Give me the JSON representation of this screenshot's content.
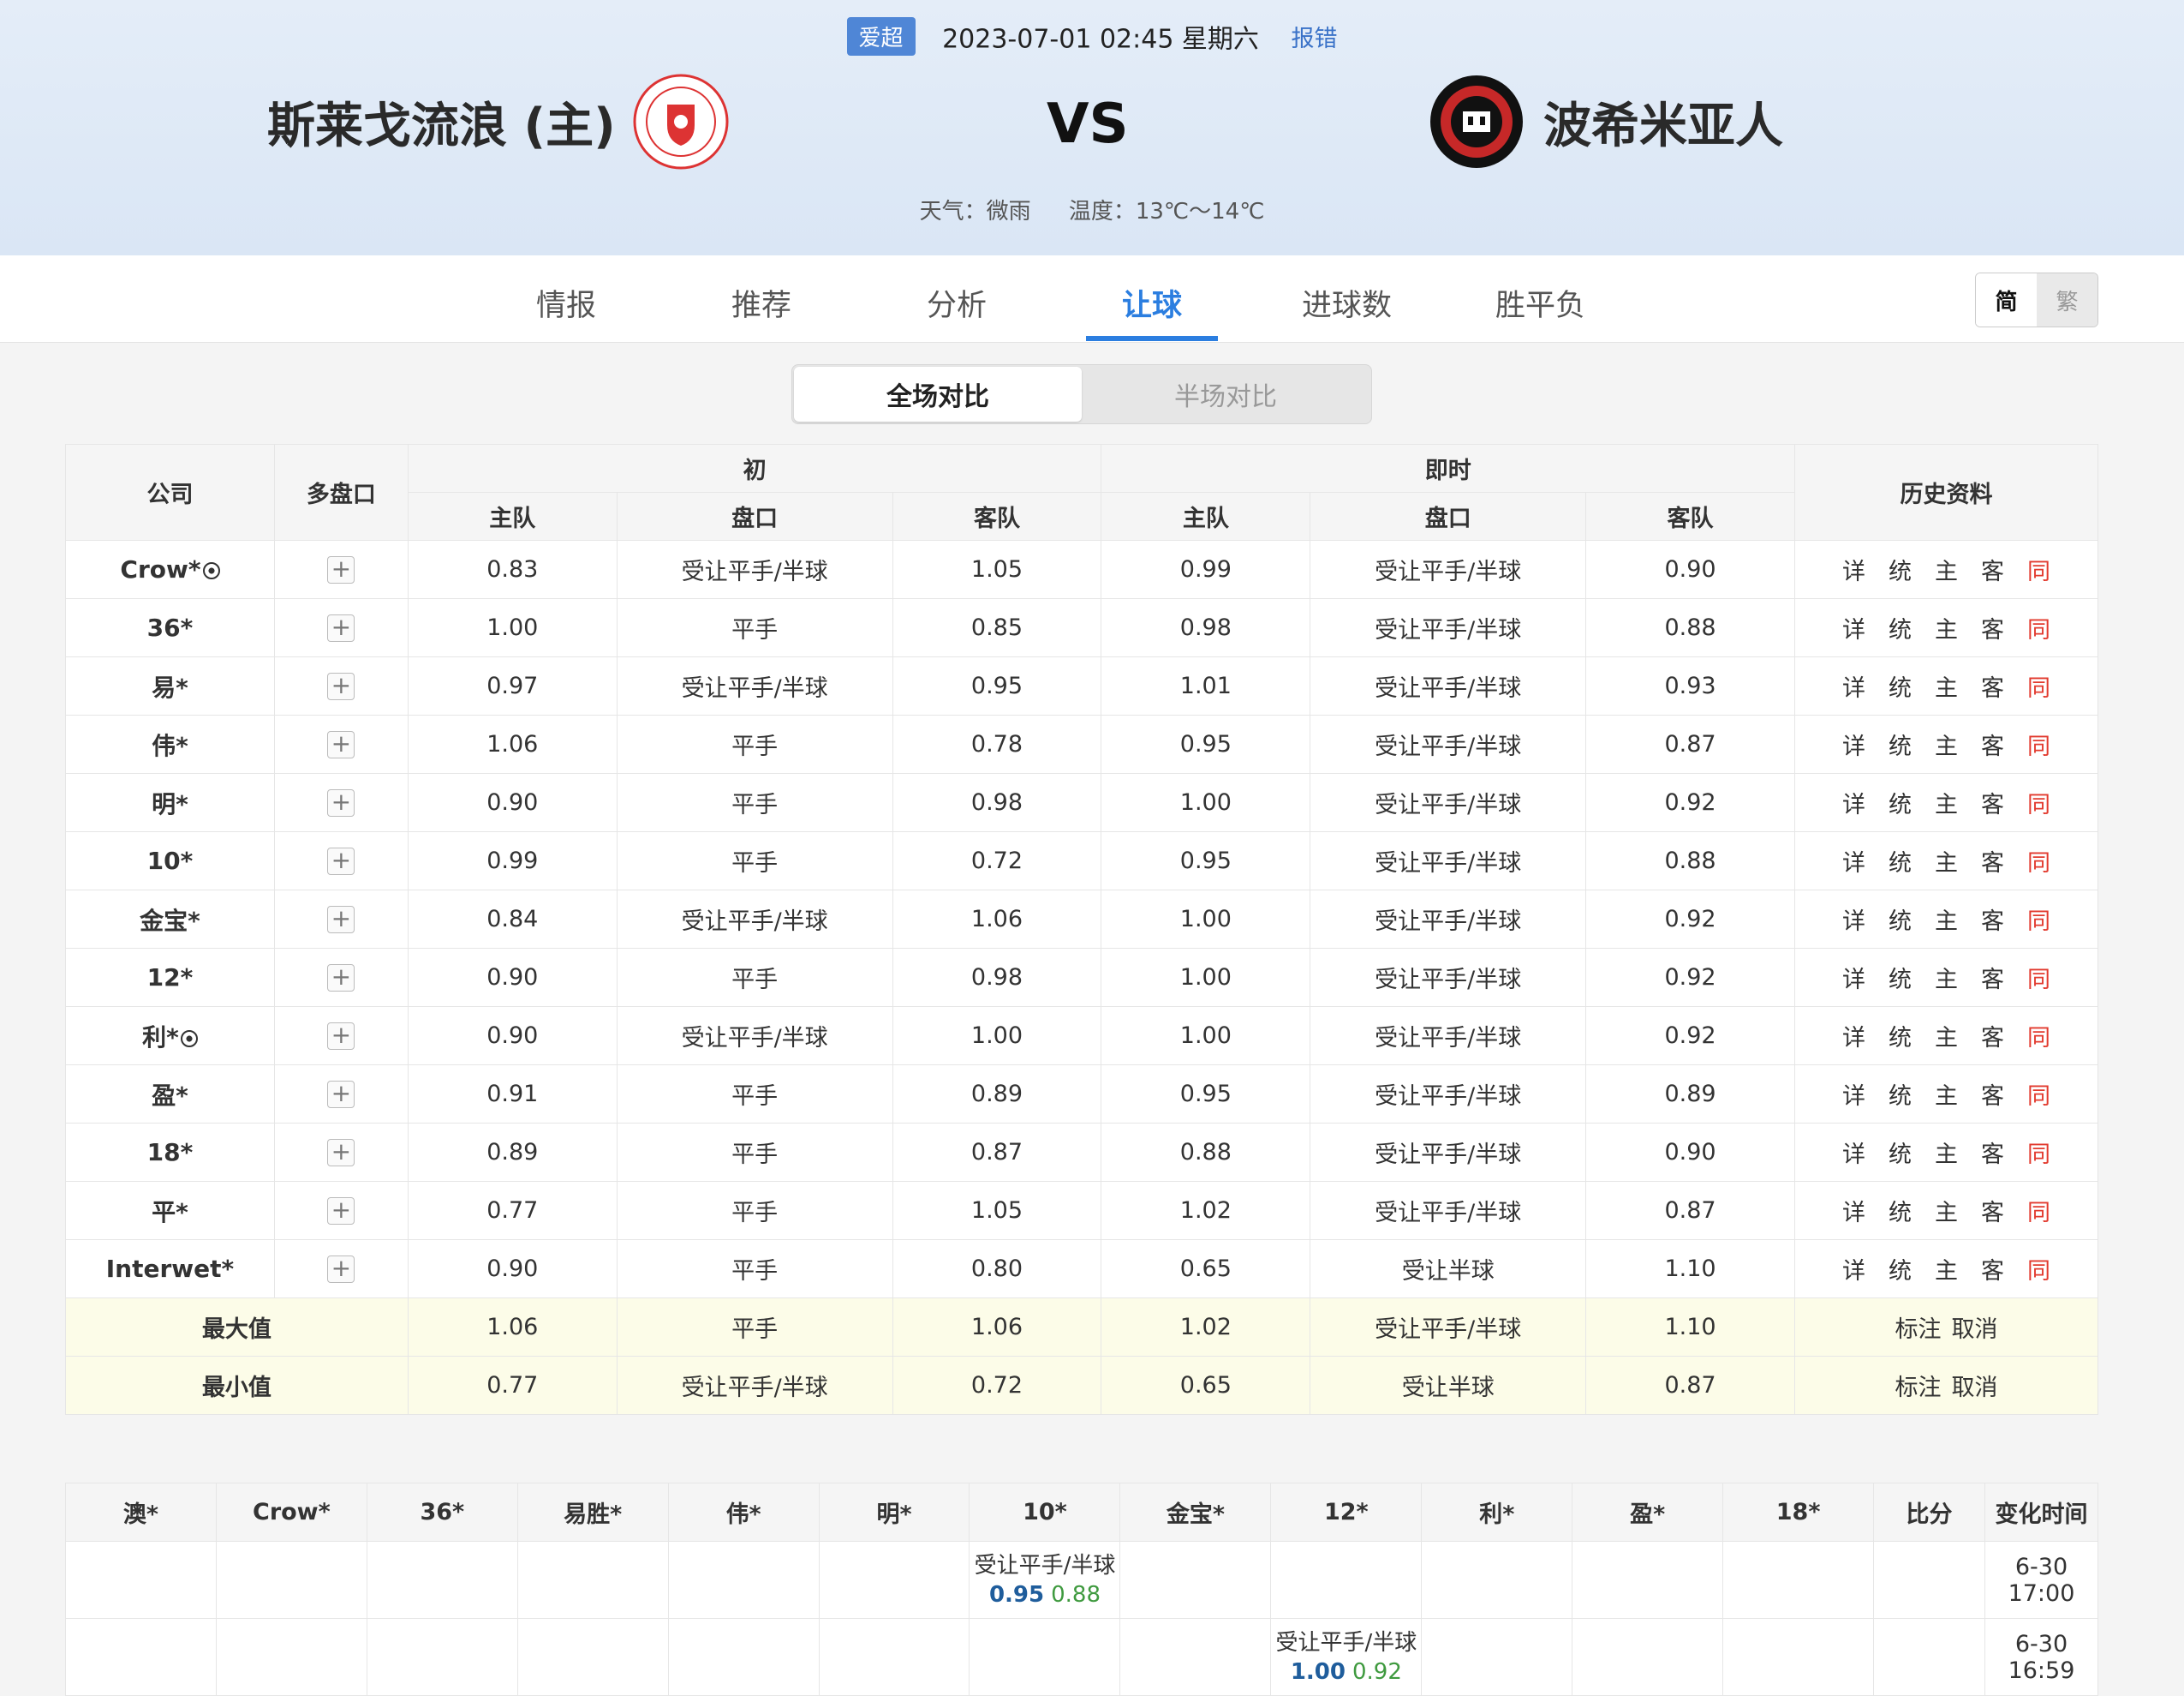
{
  "header": {
    "league": "爱超",
    "datetime": "2023-07-01 02:45 星期六",
    "report": "报错",
    "home_team": "斯莱戈流浪 (主)",
    "away_team": "波希米亚人",
    "vs": "VS",
    "weather": "天气：微雨",
    "temperature": "温度：13℃～14℃"
  },
  "nav": {
    "tabs": [
      "情报",
      "推荐",
      "分析",
      "让球",
      "进球数",
      "胜平负"
    ],
    "active": "让球",
    "lang_simplified": "简",
    "lang_traditional": "繁"
  },
  "segment": {
    "full": "全场对比",
    "half": "半场对比"
  },
  "table": {
    "headers": {
      "company": "公司",
      "multi": "多盘口",
      "initial": "初",
      "live": "即时",
      "history": "历史资料",
      "home": "主队",
      "line": "盘口",
      "away": "客队"
    },
    "history_links": [
      "详",
      "统",
      "主",
      "客",
      "同"
    ],
    "plus": "+",
    "rows": [
      {
        "company": "Crow*",
        "ball": true,
        "i_home": "0.83",
        "i_line": "受让平手/半球",
        "i_away": "1.05",
        "l_home": "0.99",
        "l_line": "受让平手/半球",
        "l_away": "0.90"
      },
      {
        "company": "36*",
        "ball": false,
        "i_home": "1.00",
        "i_line": "平手",
        "i_away": "0.85",
        "l_home": "0.98",
        "l_line": "受让平手/半球",
        "l_away": "0.88"
      },
      {
        "company": "易*",
        "ball": false,
        "i_home": "0.97",
        "i_line": "受让平手/半球",
        "i_away": "0.95",
        "l_home": "1.01",
        "l_line": "受让平手/半球",
        "l_away": "0.93"
      },
      {
        "company": "伟*",
        "ball": false,
        "i_home": "1.06",
        "i_line": "平手",
        "i_away": "0.78",
        "l_home": "0.95",
        "l_line": "受让平手/半球",
        "l_away": "0.87"
      },
      {
        "company": "明*",
        "ball": false,
        "i_home": "0.90",
        "i_line": "平手",
        "i_away": "0.98",
        "l_home": "1.00",
        "l_line": "受让平手/半球",
        "l_away": "0.92"
      },
      {
        "company": "10*",
        "ball": false,
        "i_home": "0.99",
        "i_line": "平手",
        "i_away": "0.72",
        "l_home": "0.95",
        "l_line": "受让平手/半球",
        "l_away": "0.88"
      },
      {
        "company": "金宝*",
        "ball": false,
        "i_home": "0.84",
        "i_line": "受让平手/半球",
        "i_away": "1.06",
        "l_home": "1.00",
        "l_line": "受让平手/半球",
        "l_away": "0.92"
      },
      {
        "company": "12*",
        "ball": false,
        "i_home": "0.90",
        "i_line": "平手",
        "i_away": "0.98",
        "l_home": "1.00",
        "l_line": "受让平手/半球",
        "l_away": "0.92"
      },
      {
        "company": "利*",
        "ball": true,
        "i_home": "0.90",
        "i_line": "受让平手/半球",
        "i_away": "1.00",
        "l_home": "1.00",
        "l_line": "受让平手/半球",
        "l_away": "0.92"
      },
      {
        "company": "盈*",
        "ball": false,
        "i_home": "0.91",
        "i_line": "平手",
        "i_away": "0.89",
        "l_home": "0.95",
        "l_line": "受让平手/半球",
        "l_away": "0.89"
      },
      {
        "company": "18*",
        "ball": false,
        "i_home": "0.89",
        "i_line": "平手",
        "i_away": "0.87",
        "l_home": "0.88",
        "l_line": "受让平手/半球",
        "l_away": "0.90"
      },
      {
        "company": "平*",
        "ball": false,
        "i_home": "0.77",
        "i_line": "平手",
        "i_away": "1.05",
        "l_home": "1.02",
        "l_line": "受让平手/半球",
        "l_away": "0.87"
      },
      {
        "company": "Interwet*",
        "ball": false,
        "i_home": "0.90",
        "i_line": "平手",
        "i_away": "0.80",
        "l_home": "0.65",
        "l_line": "受让半球",
        "l_away": "1.10"
      }
    ],
    "stats": [
      {
        "label": "最大值",
        "i_home": "1.06",
        "i_line": "平手",
        "i_away": "1.06",
        "l_home": "1.02",
        "l_line": "受让平手/半球",
        "l_away": "1.10"
      },
      {
        "label": "最小值",
        "i_home": "0.77",
        "i_line": "受让平手/半球",
        "i_away": "0.72",
        "l_home": "0.65",
        "l_line": "受让半球",
        "l_away": "0.87"
      }
    ],
    "stat_actions": [
      "标注",
      "取消"
    ]
  },
  "changes": {
    "headers": [
      "澳*",
      "Crow*",
      "36*",
      "易胜*",
      "伟*",
      "明*",
      "10*",
      "金宝*",
      "12*",
      "利*",
      "盈*",
      "18*",
      "比分",
      "变化时间"
    ],
    "rows": [
      {
        "col": 6,
        "line": "受让平手/半球",
        "a": "0.95",
        "b": "0.88",
        "time": "6-30 17:00"
      },
      {
        "col": 8,
        "line": "受让平手/半球",
        "a": "1.00",
        "b": "0.92",
        "time": "6-30 16:59"
      }
    ]
  },
  "colors": {
    "accent": "#2b7ee0",
    "league_badge": "#4f86d6",
    "history_red": "#e23a2e",
    "stat_row_bg": "#fcfce8"
  }
}
